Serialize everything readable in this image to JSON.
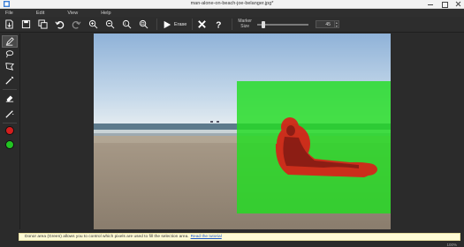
{
  "window": {
    "title": "man-alone-on-beach-joe-belanger.jpg*"
  },
  "menu": [
    "File",
    "Edit",
    "View",
    "Help"
  ],
  "toolbar": {
    "erase_label": "Erase",
    "marker_size_label_1": "Marker",
    "marker_size_label_2": "Size",
    "marker_size_value": "45",
    "marker_size_fraction": 0.1
  },
  "status": {
    "hint_text": "Donor area (Green) allows you to control which pixels are used to fill the selection area.",
    "hint_link": "Read the tutorial",
    "zoom": "100%"
  },
  "colors": {
    "selection_red": "#e01818",
    "donor_green": "#22cc22"
  }
}
